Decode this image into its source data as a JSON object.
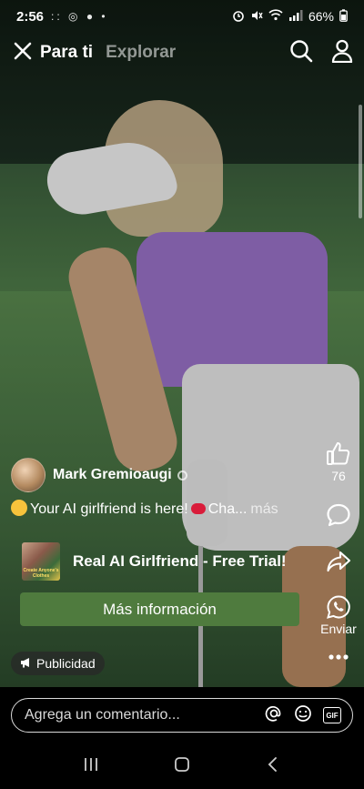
{
  "status_bar": {
    "time": "2:56",
    "left_indicators": ":: ◎ ●  •",
    "battery": "66%"
  },
  "top_nav": {
    "tab_active": "Para ti",
    "tab_inactive": "Explorar"
  },
  "post": {
    "author": "Mark Gremioaugi",
    "caption_part1": "Your AI girlfriend is here!",
    "caption_part2": "Cha...",
    "more_label": "más",
    "likes_count": "76"
  },
  "promo": {
    "title": "Real AI Girlfriend - Free Trial!",
    "cta_label": "Más información",
    "thumb_text": "Create Anyone's Clothes"
  },
  "sponsored_label": "Publicidad",
  "actions": {
    "share_label": "Enviar"
  },
  "comment": {
    "placeholder": "Agrega un comentario..."
  },
  "colors": {
    "cta_background": "#4f7b3e",
    "background": "#000000"
  }
}
